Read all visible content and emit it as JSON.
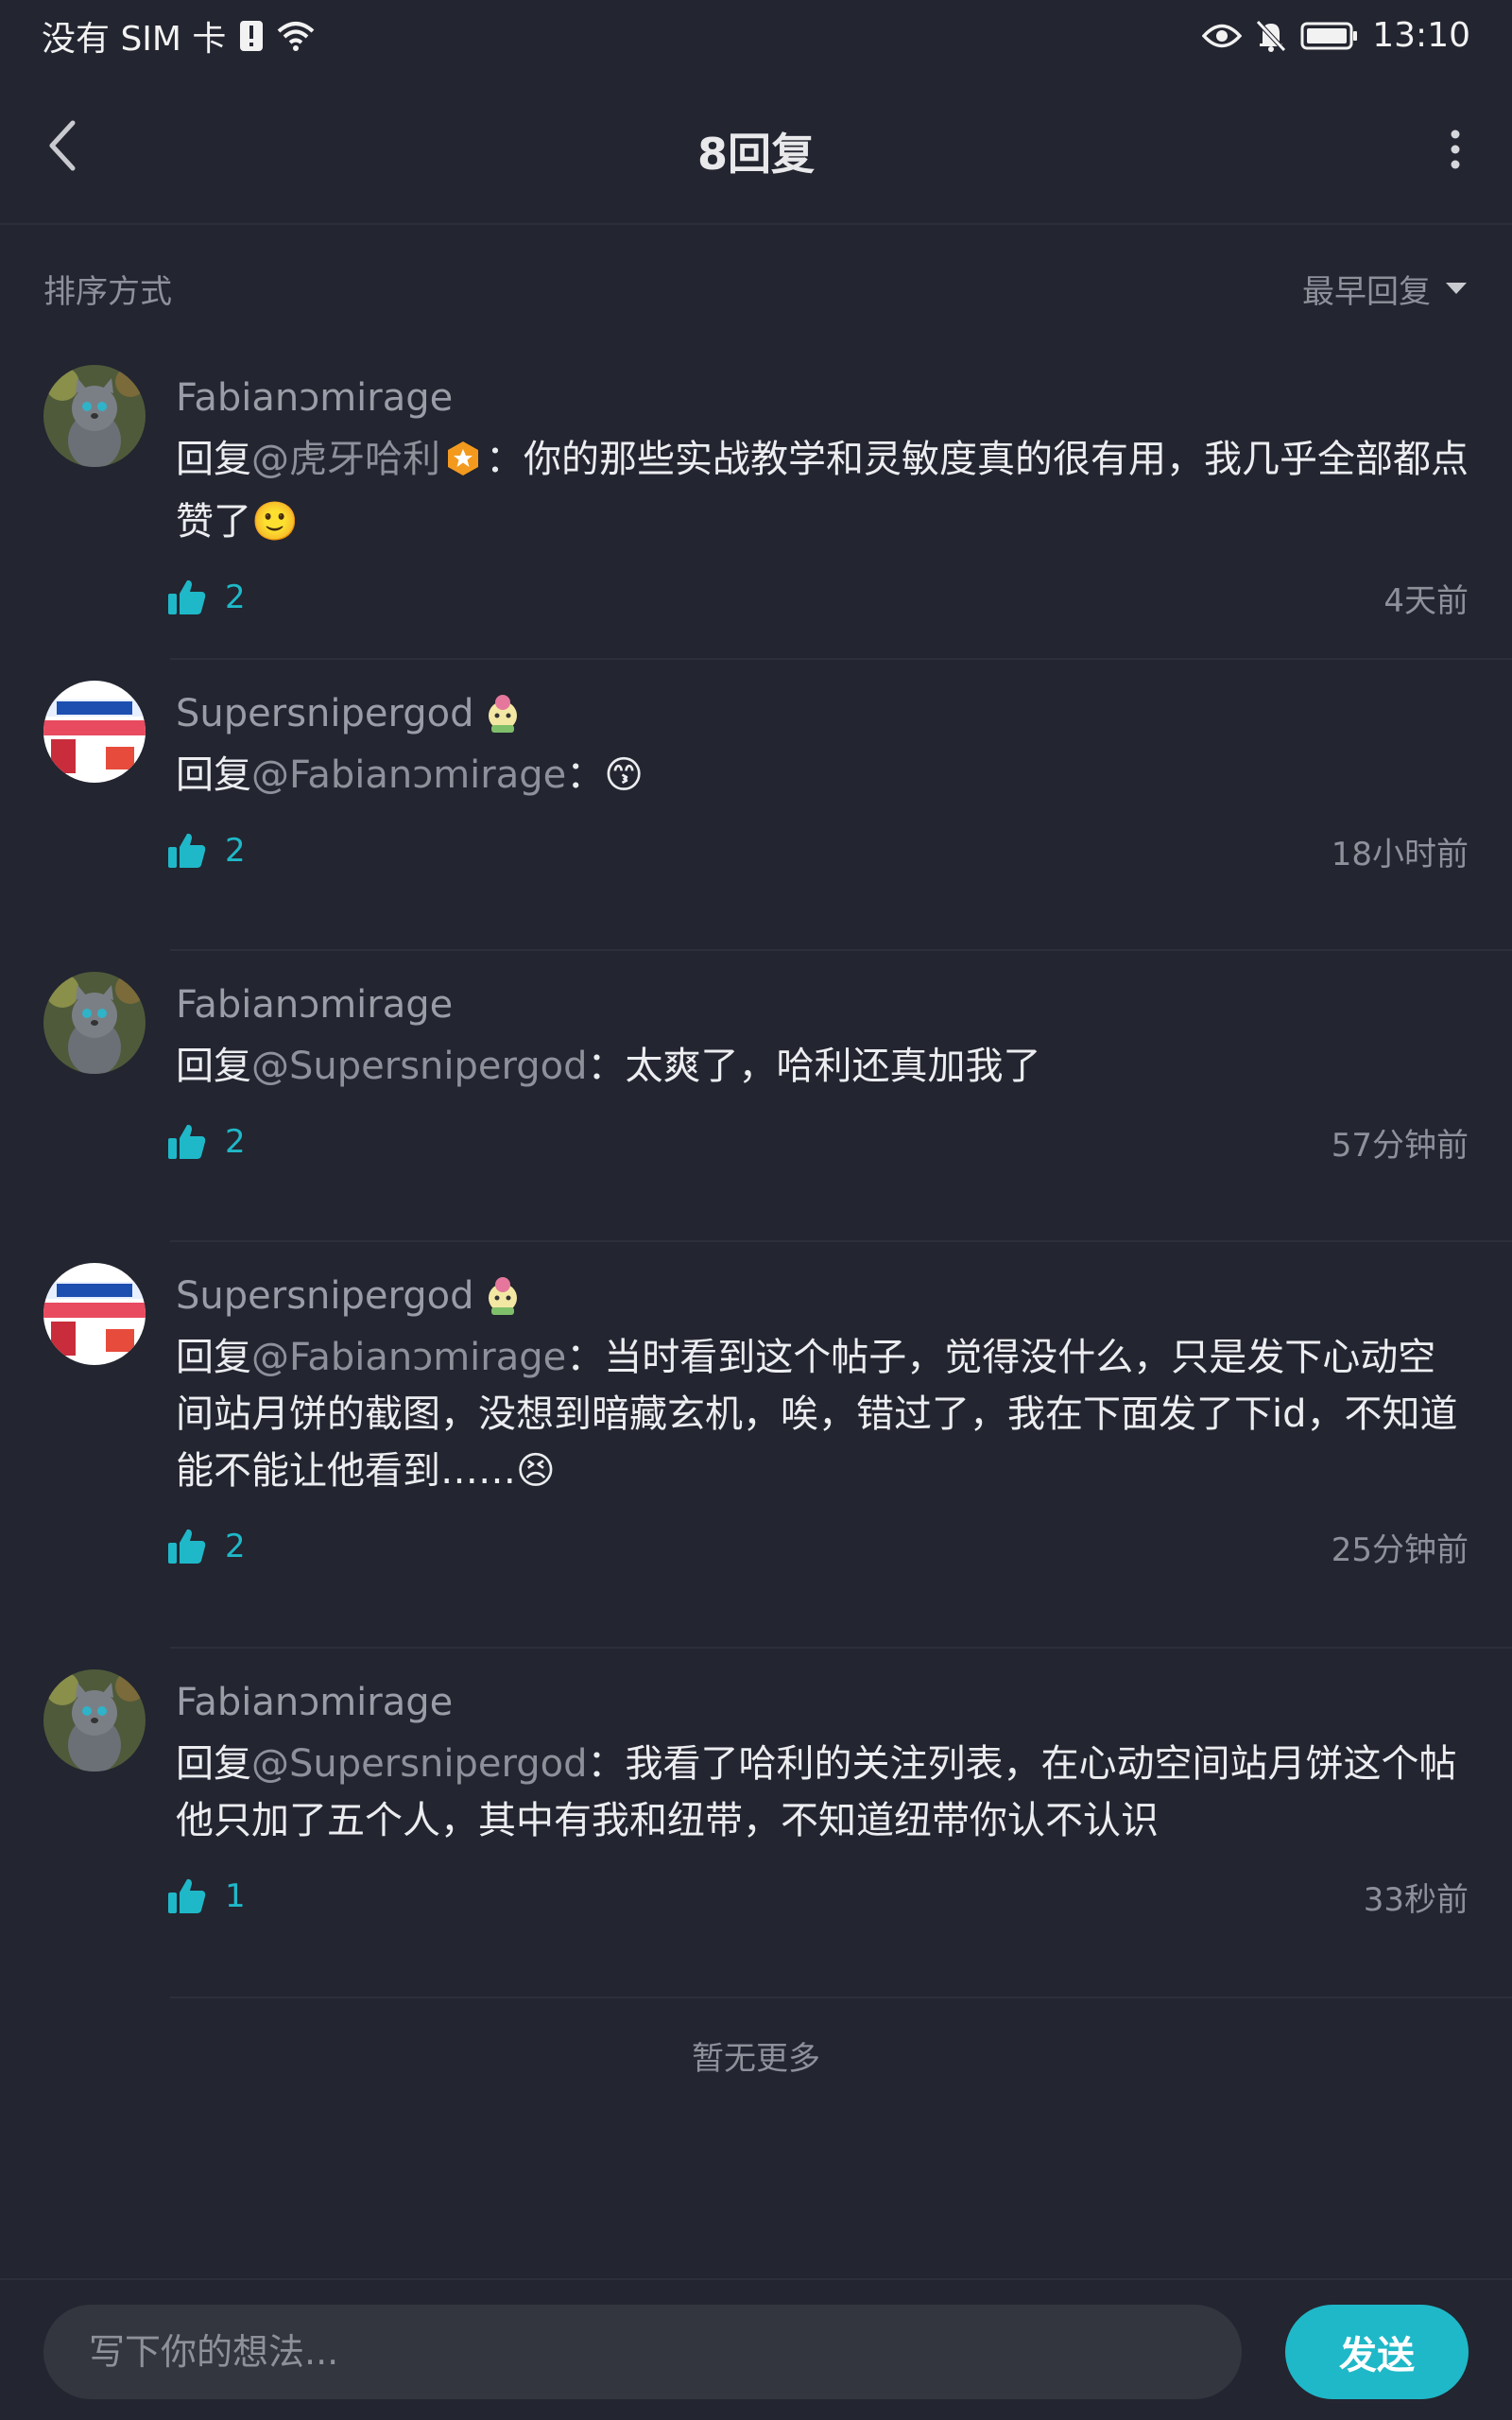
{
  "status_bar": {
    "carrier": "没有 SIM 卡",
    "time": "13:10"
  },
  "header": {
    "title": "8回复"
  },
  "sort": {
    "label": "排序方式",
    "selected": "最早回复"
  },
  "replies": [
    {
      "username": "Fabianↄmirage",
      "reply_prefix": "回复",
      "mention": "@虎牙哈利",
      "text": "：你的那些实战教学和灵敏度真的很有用，我几乎全部都点赞了🙂",
      "likes": "2",
      "time": "4天前",
      "avatar": "cat-avatar"
    },
    {
      "username": "Supersnipergod",
      "reply_prefix": "回复",
      "mention": "@Fabianↄmirage",
      "text": "：😙",
      "likes": "2",
      "time": "18小时前",
      "avatar": "erke-avatar"
    },
    {
      "username": "Fabianↄmirage",
      "reply_prefix": "回复",
      "mention": "@Supersnipergod",
      "text": "：太爽了，哈利还真加我了",
      "likes": "2",
      "time": "57分钟前",
      "avatar": "cat-avatar"
    },
    {
      "username": "Supersnipergod",
      "reply_prefix": "回复",
      "mention": "@Fabianↄmirage",
      "text": "：当时看到这个帖子，觉得没什么，只是发下心动空间站月饼的截图，没想到暗藏玄机，唉，错过了，我在下面发了下id，不知道能不能让他看到……😣",
      "likes": "2",
      "time": "25分钟前",
      "avatar": "erke-avatar"
    },
    {
      "username": "Fabianↄmirage",
      "reply_prefix": "回复",
      "mention": "@Supersnipergod",
      "text": "：我看了哈利的关注列表，在心动空间站月饼这个帖他只加了五个人，其中有我和纽带，不知道纽带你认不认识",
      "likes": "1",
      "time": "33秒前",
      "avatar": "cat-avatar"
    }
  ],
  "footer": {
    "no_more": "暂无更多"
  },
  "composer": {
    "placeholder": "写下你的想法...",
    "send_label": "发送"
  },
  "colors": {
    "background": "#232530",
    "accent": "#1fb8c8",
    "muted_text": "#8e909a",
    "primary_text": "#ecedf0"
  }
}
